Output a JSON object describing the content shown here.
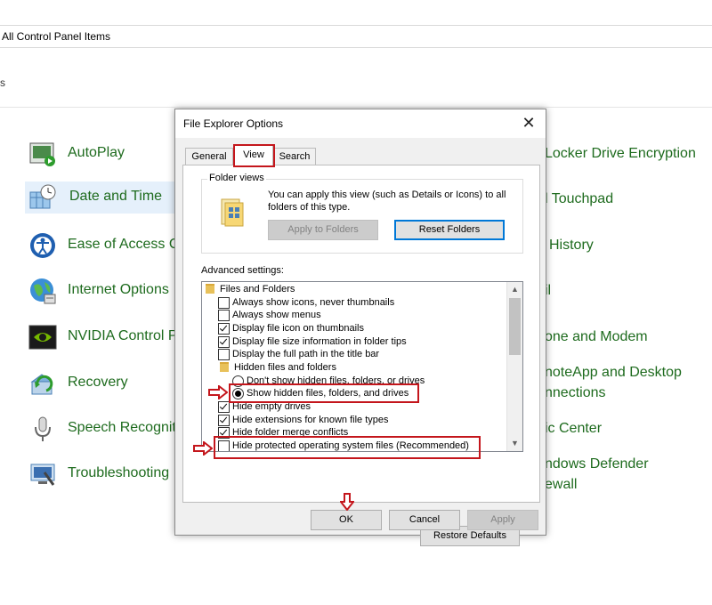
{
  "address_bar": {
    "text": "All Control Panel Items"
  },
  "left_fragment": "s",
  "control_panel": {
    "left_items": [
      {
        "label": "AutoPlay",
        "icon": "autoplay-icon"
      },
      {
        "label": "Date and Time",
        "icon": "clock-calendar-icon"
      },
      {
        "label": "Ease of Access Ce",
        "icon": "ease-of-access-icon"
      },
      {
        "label": "Internet Options",
        "icon": "globe-icon"
      },
      {
        "label": "NVIDIA Control P",
        "icon": "nvidia-icon"
      },
      {
        "label": "Recovery",
        "icon": "recovery-icon"
      },
      {
        "label": "Speech Recogniti",
        "icon": "microphone-icon"
      },
      {
        "label": "Troubleshooting",
        "icon": "troubleshooting-icon"
      }
    ],
    "right_fragments": [
      "Locker Drive Encryption",
      "l Touchpad",
      "History",
      "il",
      "one and Modem",
      "noteApp and Desktop",
      "nnections",
      "ic Center",
      "ndows Defender",
      "ewall"
    ]
  },
  "dialog": {
    "title": "File Explorer Options",
    "close_glyph": "✕",
    "tabs": [
      "General",
      "View",
      "Search"
    ],
    "folder_views": {
      "title": "Folder views",
      "description": "You can apply this view (such as Details or Icons) to all folders of this type.",
      "apply_label": "Apply to Folders",
      "reset_label": "Reset Folders"
    },
    "advanced_label": "Advanced settings:",
    "settings": [
      {
        "type": "folder",
        "label": "Files and Folders"
      },
      {
        "type": "checkbox",
        "checked": false,
        "label": "Always show icons, never thumbnails"
      },
      {
        "type": "checkbox",
        "checked": false,
        "label": "Always show menus"
      },
      {
        "type": "checkbox",
        "checked": true,
        "label": "Display file icon on thumbnails"
      },
      {
        "type": "checkbox",
        "checked": true,
        "label": "Display file size information in folder tips"
      },
      {
        "type": "checkbox",
        "checked": false,
        "label": "Display the full path in the title bar"
      },
      {
        "type": "folder",
        "label": "Hidden files and folders"
      },
      {
        "type": "radio",
        "checked": false,
        "label": "Don't show hidden files, folders, or drives"
      },
      {
        "type": "radio",
        "checked": true,
        "label": "Show hidden files, folders, and drives"
      },
      {
        "type": "checkbox",
        "checked": true,
        "label": "Hide empty drives"
      },
      {
        "type": "checkbox",
        "checked": true,
        "label": "Hide extensions for known file types"
      },
      {
        "type": "checkbox",
        "checked": true,
        "label": "Hide folder merge conflicts"
      },
      {
        "type": "checkbox",
        "checked": false,
        "label": "Hide protected operating system files (Recommended)"
      }
    ],
    "restore_defaults_label": "Restore Defaults",
    "ok_label": "OK",
    "cancel_label": "Cancel",
    "apply_label": "Apply"
  },
  "colors": {
    "highlight": "#c4161c",
    "link_green": "#1e6b1e",
    "accent": "#0078d7"
  }
}
